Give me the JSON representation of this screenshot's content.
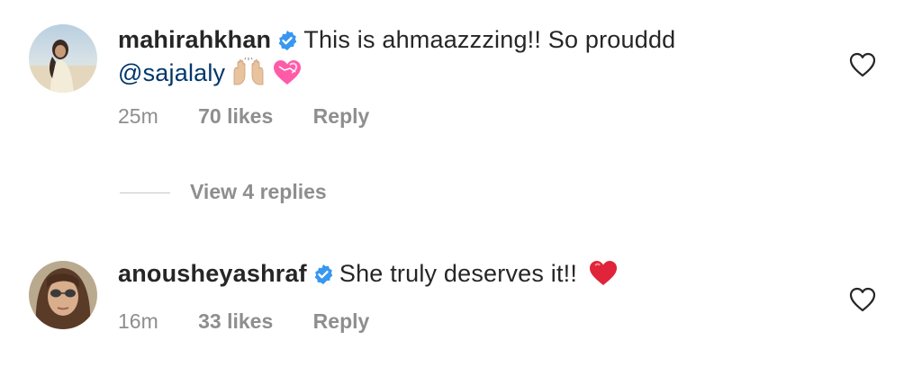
{
  "comments": [
    {
      "username": "mahirahkhan",
      "verified": true,
      "text": "This is ahmaazzzing!! So prouddd",
      "mention": "@sajalaly",
      "emojis": [
        "raising-hands-emoji",
        "heart-with-ribbon-emoji"
      ],
      "time": "25m",
      "likes": "70 likes",
      "reply_label": "Reply"
    },
    {
      "username": "anousheyashraf",
      "verified": true,
      "text": "She truly deserves it!!",
      "emojis": [
        "red-heart-emoji"
      ],
      "time": "16m",
      "likes": "33 likes",
      "reply_label": "Reply"
    }
  ],
  "view_replies": "View 4 replies",
  "colors": {
    "text": "#262626",
    "muted": "#8e8e8e",
    "mention": "#00376b",
    "verified": "#3897f0",
    "heart_emoji": "#e0243a"
  },
  "icons": [
    "verified-badge-icon",
    "like-heart-outline-icon"
  ]
}
